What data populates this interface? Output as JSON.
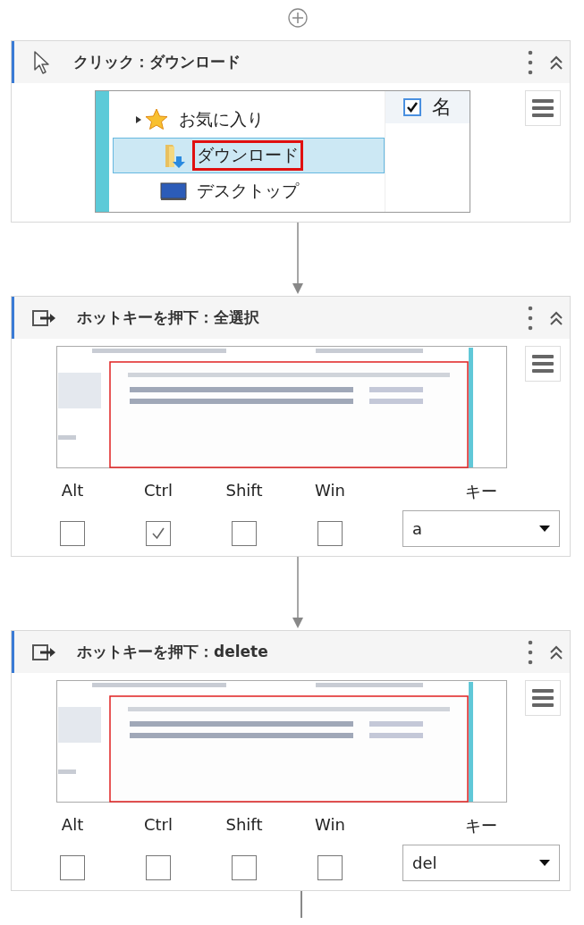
{
  "activities": [
    {
      "kind": "click",
      "title": "クリック：ダウンロード",
      "screenshot": {
        "tree": [
          {
            "label": "お気に入り",
            "kind": "favorites",
            "selected": false
          },
          {
            "label": "ダウンロード",
            "kind": "download",
            "selected": true
          },
          {
            "label": "デスクトップ",
            "kind": "desktop",
            "selected": false
          }
        ],
        "header_checked": true,
        "column_header": "名"
      }
    },
    {
      "kind": "hotkey",
      "title": "ホットキーを押下：全選択",
      "modifiers": [
        {
          "label": "Alt",
          "checked": false
        },
        {
          "label": "Ctrl",
          "checked": true
        },
        {
          "label": "Shift",
          "checked": false
        },
        {
          "label": "Win",
          "checked": false
        }
      ],
      "key_label": "キー",
      "key": "a"
    },
    {
      "kind": "hotkey",
      "title": "ホットキーを押下：delete",
      "modifiers": [
        {
          "label": "Alt",
          "checked": false
        },
        {
          "label": "Ctrl",
          "checked": false
        },
        {
          "label": "Shift",
          "checked": false
        },
        {
          "label": "Win",
          "checked": false
        }
      ],
      "key_label": "キー",
      "key": "del"
    }
  ]
}
